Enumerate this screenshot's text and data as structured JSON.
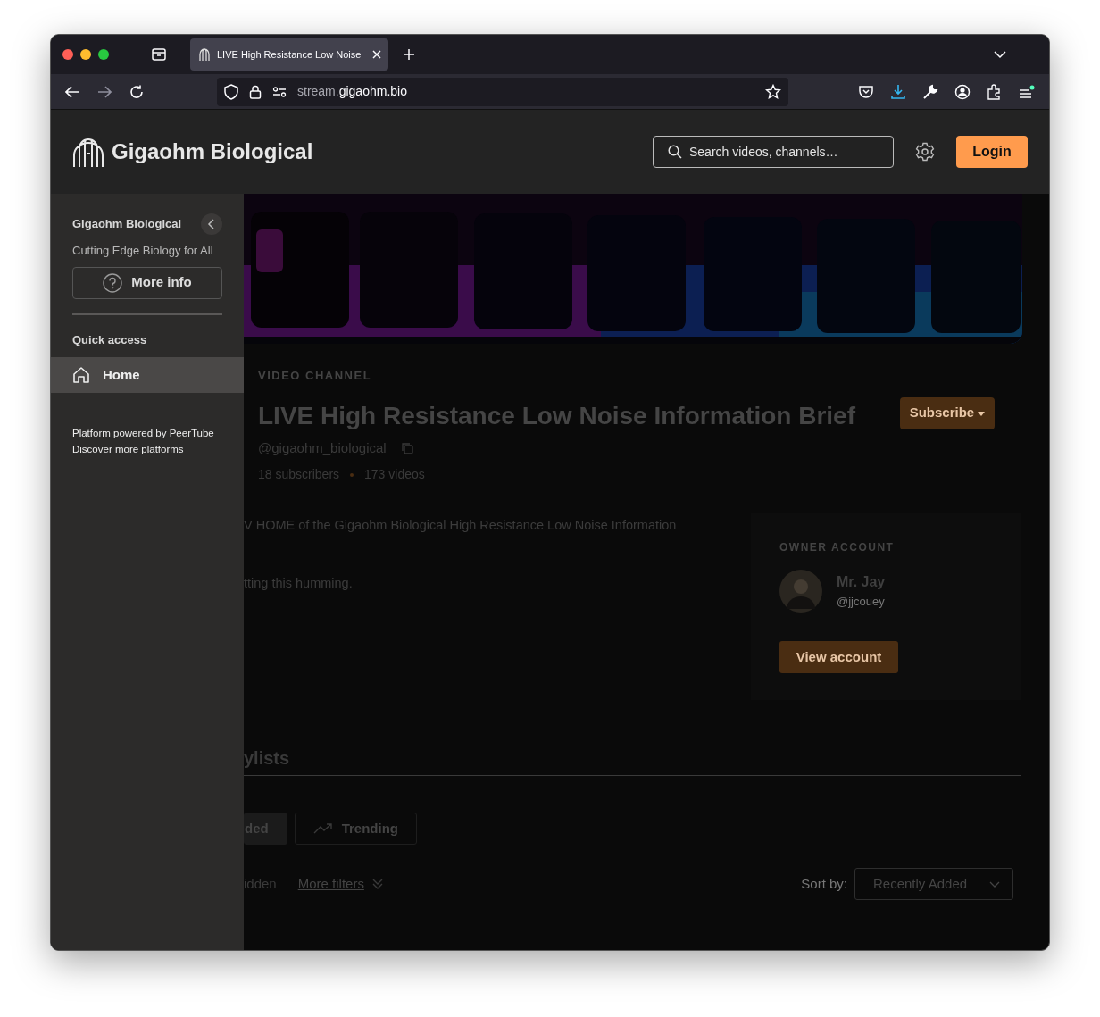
{
  "browser": {
    "tab_title": "LIVE High Resistance Low Noise",
    "url_subdomain": "stream.",
    "url_domain": "gigaohm.bio"
  },
  "header": {
    "site_name": "Gigaohm Biological",
    "search_placeholder": "Search videos, channels…",
    "login": "Login"
  },
  "sidebar": {
    "title": "Gigaohm Biological",
    "subtitle": "Cutting Edge Biology for All",
    "more_info": "More info",
    "section": "Quick access",
    "items": [
      {
        "label": "Home",
        "selected": true
      }
    ],
    "footer_text": "Platform powered by ",
    "footer_link": "PeerTube",
    "discover_link": "Discover more platforms"
  },
  "channel": {
    "kicker": "VIDEO CHANNEL",
    "title": "LIVE High Resistance Low Noise Information Brief",
    "handle": "@gigaohm_biological",
    "subscribers": "18 subscribers",
    "videos": "173 videos",
    "subscribe": "Subscribe",
    "description": [
      "V HOME of the Gigaohm Biological High Resistance Low Noise Information",
      "tting this humming."
    ]
  },
  "owner": {
    "heading": "OWNER ACCOUNT",
    "name": "Mr. Jay",
    "handle": "@jjcouey",
    "button": "View account"
  },
  "section_heading": "ylists",
  "filter_tabs": [
    {
      "label": "ded",
      "selected": true
    },
    {
      "label": "Trending",
      "selected": false
    }
  ],
  "filters": {
    "hidden_label": "idden",
    "more_filters": "More filters",
    "sort_label": "Sort by:",
    "sort_value": "Recently Added"
  }
}
